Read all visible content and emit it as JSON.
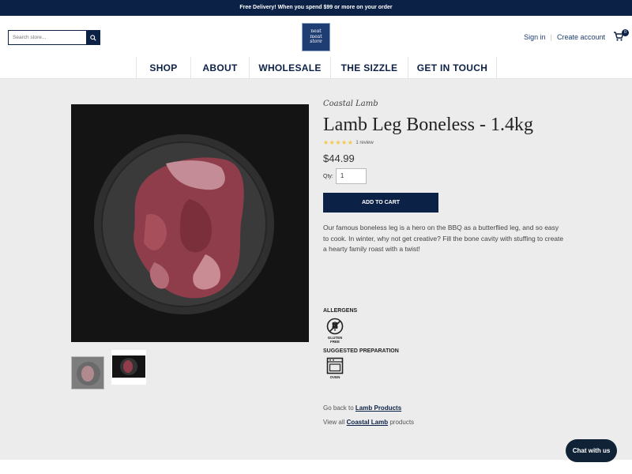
{
  "promo": {
    "text": "Free Delivery! When you spend $99 or more on your order"
  },
  "header": {
    "search_placeholder": "Search store...",
    "logo_lines": [
      "neat",
      "meat",
      "store"
    ],
    "sign_in": "Sign in",
    "separator": "|",
    "create_account": "Create account",
    "cart_count": "0"
  },
  "nav": {
    "items": [
      {
        "label": "SHOP"
      },
      {
        "label": "ABOUT"
      },
      {
        "label": "WHOLESALE"
      },
      {
        "label": "THE SIZZLE"
      },
      {
        "label": "GET IN TOUCH"
      }
    ]
  },
  "product": {
    "brand": "Coastal Lamb",
    "title": "Lamb Leg Boneless - 1.4kg",
    "stars": "★★★★★",
    "rating_value": 5,
    "review_count": "1 review",
    "price": "$44.99",
    "qty_label": "Qty:",
    "qty_value": "1",
    "add_to_cart": "ADD TO CART",
    "description": "Our famous boneless leg is a hero on the BBQ as a butterflied leg, and so easy to cook.  In winter, why not get creative?  Fill the bone cavity with stuffing to create a hearty family roast with a twist!",
    "allergens_label": "ALLERGENS",
    "gluten_free": "GLUTEN FREE",
    "prep_label": "SUGGESTED PREPARATION",
    "oven": "OVEN",
    "go_back_prefix": "Go back to",
    "go_back_link": "Lamb Products",
    "view_all_prefix": "View all",
    "view_all_link": "Coastal Lamb",
    "view_all_suffix": "products"
  },
  "chat": {
    "label": "Chat with us"
  },
  "colors": {
    "navy": "#0c2146",
    "star": "#f2c94c",
    "page_bg": "#ececec"
  }
}
